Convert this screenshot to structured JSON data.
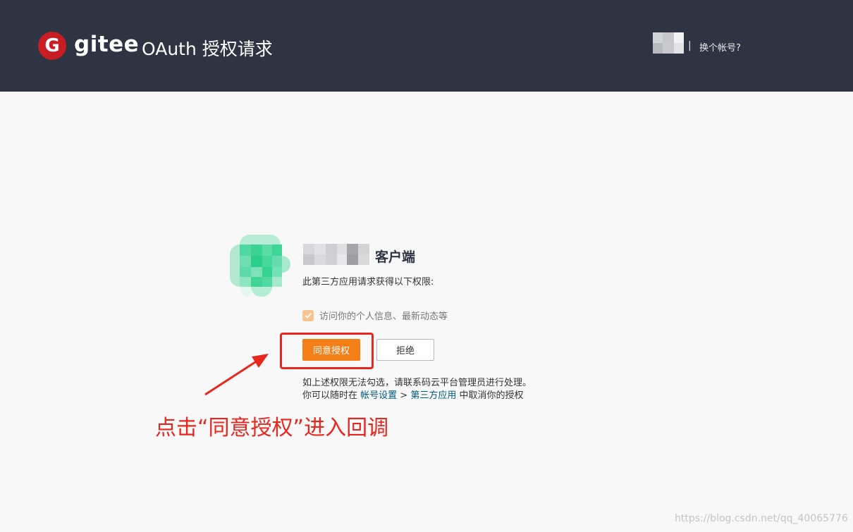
{
  "header": {
    "logo_letter": "G",
    "logo_text": "gitee",
    "title": "OAuth 授权请求",
    "separator": "|",
    "switch_account": "换个帐号?"
  },
  "app": {
    "title_suffix": "客户端",
    "intro": "此第三方应用请求获得以下权限:",
    "permission_label": "访问你的个人信息、最新动态等",
    "permission_checked": true
  },
  "actions": {
    "agree_label": "同意授权",
    "reject_label": "拒绝"
  },
  "notes": {
    "line1": "如上述权限无法勾选，请联系码云平台管理员进行处理。",
    "line2_prefix": "你可以随时在 ",
    "link_account_settings": "帐号设置",
    "line2_separator": " > ",
    "link_third_party_apps": "第三方应用",
    "line2_suffix": " 中取消你的授权"
  },
  "annotation": {
    "text": "点击“同意授权”进入回调"
  },
  "watermark": "https://blog.csdn.net/qq_40065776",
  "colors": {
    "header_bg": "#2e3442",
    "brand_red": "#c71d23",
    "agree_orange": "#f57f17",
    "link_blue": "#005980",
    "annotation_red": "#e8261d",
    "checkbox_orange": "#f8c48d"
  }
}
